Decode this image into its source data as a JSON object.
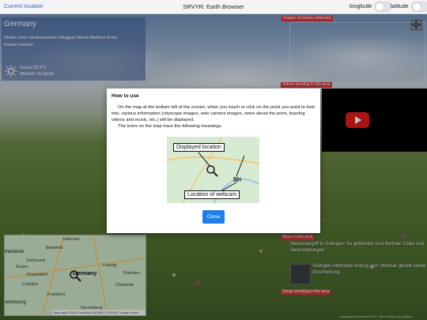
{
  "topbar": {
    "current_location": "Current location",
    "title": "SRVYR: Earth Browser",
    "longitude_label": "longitude",
    "latitude_label": "latitude"
  },
  "info": {
    "country": "Germany",
    "address_line1": "Straße ohne Straßennamen Ringgau Werra-Meißner-Kreis",
    "address_line2": "Kassel Hessen",
    "weather_line1": "Sunny:23.9℃",
    "weather_line2": "Wind:W 10.2km/h"
  },
  "right": {
    "webcam_label": "Images of nearby webcams",
    "video_label": "Videos trending in this area",
    "news_label": "News in this area",
    "news1": "Messerangriff in Solingen: So gefährdet sind Berliner Clubs und Veranstaltungen",
    "news2": "Solingen-Attentäter entzog sich offenbar gezielt seiner Abschiebung",
    "songs_label": "Songs trending in this area"
  },
  "map": {
    "cities": [
      "Hanover",
      "Bielefeld",
      "Dortmund",
      "Essen",
      "Düsseldorf",
      "Cologne",
      "Leipzig",
      "Dresden",
      "Frankfurt",
      "Chemnitz",
      "Nuremberg"
    ],
    "country_main": "Germany",
    "nl": "therlands",
    "lux": "xembourg",
    "footer": "Map data ©2024 GeoBasis-DE/BKG (©2009), Google   Terms"
  },
  "footer_right": "Keyboard shortcuts   © M.K.   Terms   Report a problem",
  "modal": {
    "title": "How to use",
    "body1": "On the map at the bottom left of the screen, when you touch or click on the point you want to look into, various information (cityscape images, web camera images, news about the point, buzzing videos and music, etc.) will be displayed.",
    "body2": "The icons on the map have the following meanings.",
    "label_location": "Displayed location",
    "label_webcam": "Location of webcam",
    "close": "Close"
  }
}
